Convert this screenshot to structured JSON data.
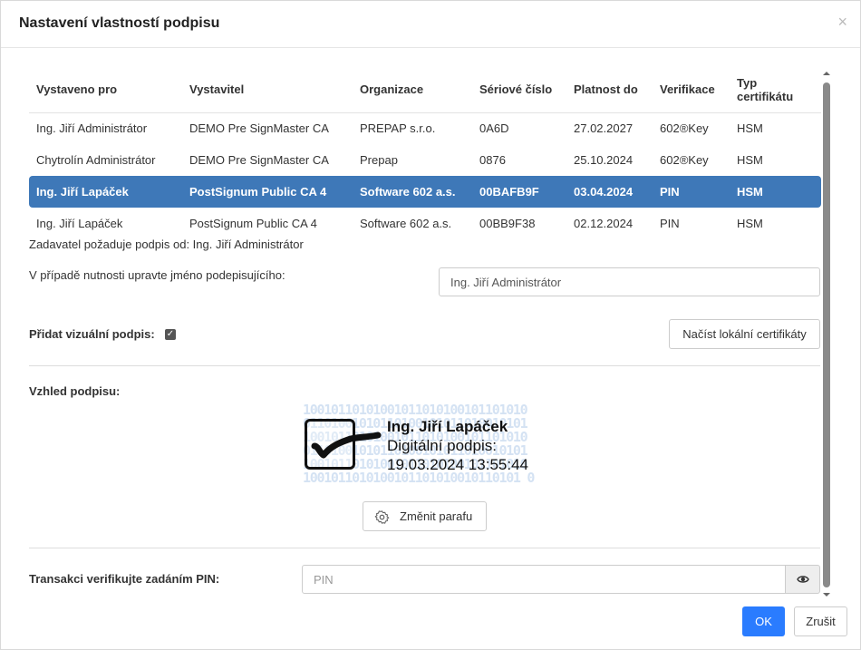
{
  "dialog": {
    "title": "Nastavení vlastností podpisu",
    "close_glyph": "×"
  },
  "table": {
    "headers": [
      "Vystaveno pro",
      "Vystavitel",
      "Organizace",
      "Sériové číslo",
      "Platnost do",
      "Verifikace",
      "Typ certifikátu"
    ],
    "header_typ_line1": "Typ",
    "header_typ_line2": "certifikátu",
    "rows": [
      {
        "issued_to": "Ing. Jiří Administrátor",
        "issuer": "DEMO Pre SignMaster CA",
        "org": "PREPAP s.r.o.",
        "serial": "0A6D",
        "valid": "27.02.2027",
        "verification": "602®Key",
        "type": "HSM",
        "selected": false
      },
      {
        "issued_to": "Chytrolín Administrátor",
        "issuer": "DEMO Pre SignMaster CA",
        "org": "Prepap",
        "serial": "0876",
        "valid": "25.10.2024",
        "verification": "602®Key",
        "type": "HSM",
        "selected": false
      },
      {
        "issued_to": "Ing. Jiří Lapáček",
        "issuer": "PostSignum Public CA 4",
        "org": "Software 602 a.s.",
        "serial": "00BAFB9F",
        "valid": "03.04.2024",
        "verification": "PIN",
        "type": "HSM",
        "selected": true
      },
      {
        "issued_to": "Ing. Jiří Lapáček",
        "issuer": "PostSignum Public CA 4",
        "org": "Software 602 a.s.",
        "serial": "00BB9F38",
        "valid": "02.12.2024",
        "verification": "PIN",
        "type": "HSM",
        "selected": false
      }
    ],
    "selected_color": "#3e78b8"
  },
  "requester_info": "Zadavatel požaduje podpis od: Ing. Jiří Administrátor",
  "rename": {
    "label": "V případě nutnosti upravte jméno podepisujícího:",
    "value": "Ing. Jiří Administrátor"
  },
  "visual": {
    "label": "Přidat vizuální podpis:",
    "checked": true,
    "check_glyph": "✓",
    "load_button": "Načíst lokální certifikáty"
  },
  "appearance": {
    "label": "Vzhled podpisu:",
    "binary_lines": [
      "10010110101001011010100101101010",
      "01101001010110100101011010010101",
      "10010110101001011010100101101010",
      "01101001010110100101011010010101",
      "10010110101001011010100101101010",
      "1001011010100101101010010110101 0"
    ],
    "sig_name": "Ing. Jiří Lapáček",
    "sig_line2": "Digitální podpis:",
    "sig_line3": "19.03.2024 13:55:44",
    "change_button": "Změnit parafu"
  },
  "pin": {
    "label": "Transakci verifikujte zadáním PIN:",
    "placeholder": "PIN"
  },
  "footer": {
    "ok": "OK",
    "cancel": "Zrušit",
    "ok_color": "#2a7cff"
  }
}
